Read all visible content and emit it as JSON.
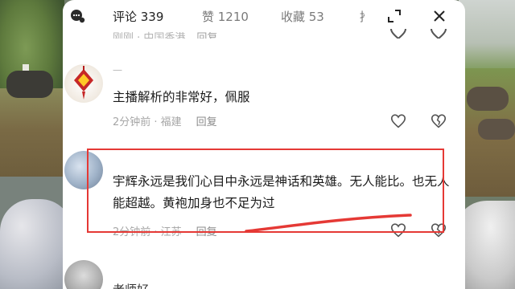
{
  "header": {
    "tabs": [
      {
        "label": "评论 339",
        "active": true
      },
      {
        "label": "赞 1210",
        "active": false
      },
      {
        "label": "收藏 53",
        "active": false
      },
      {
        "label": "推",
        "active": false
      }
    ],
    "icons": {
      "left": "comment-bubble-icon",
      "expand": "expand-icon",
      "close": "close-icon"
    }
  },
  "clipped_comment": {
    "meta": "刚刚 · 中国香港",
    "reply_label": "回复"
  },
  "comments": [
    {
      "username": "一",
      "text": "主播解析的非常好，佩服",
      "meta": "2分钟前 · 福建",
      "reply_label": "回复"
    },
    {
      "username": "",
      "text": "宇辉永远是我们心目中永远是神话和英雄。无人能比。也无人能超越。黄袍加身也不足为过",
      "meta": "2分钟前 · 江苏",
      "reply_label": "回复"
    },
    {
      "username": "老师好",
      "text": "",
      "meta": "",
      "reply_label": ""
    }
  ],
  "colors": {
    "highlight": "#e53935",
    "panel_bg": "#ffffff",
    "text_primary": "#1a1a1a",
    "text_secondary": "#a6a6a6"
  }
}
